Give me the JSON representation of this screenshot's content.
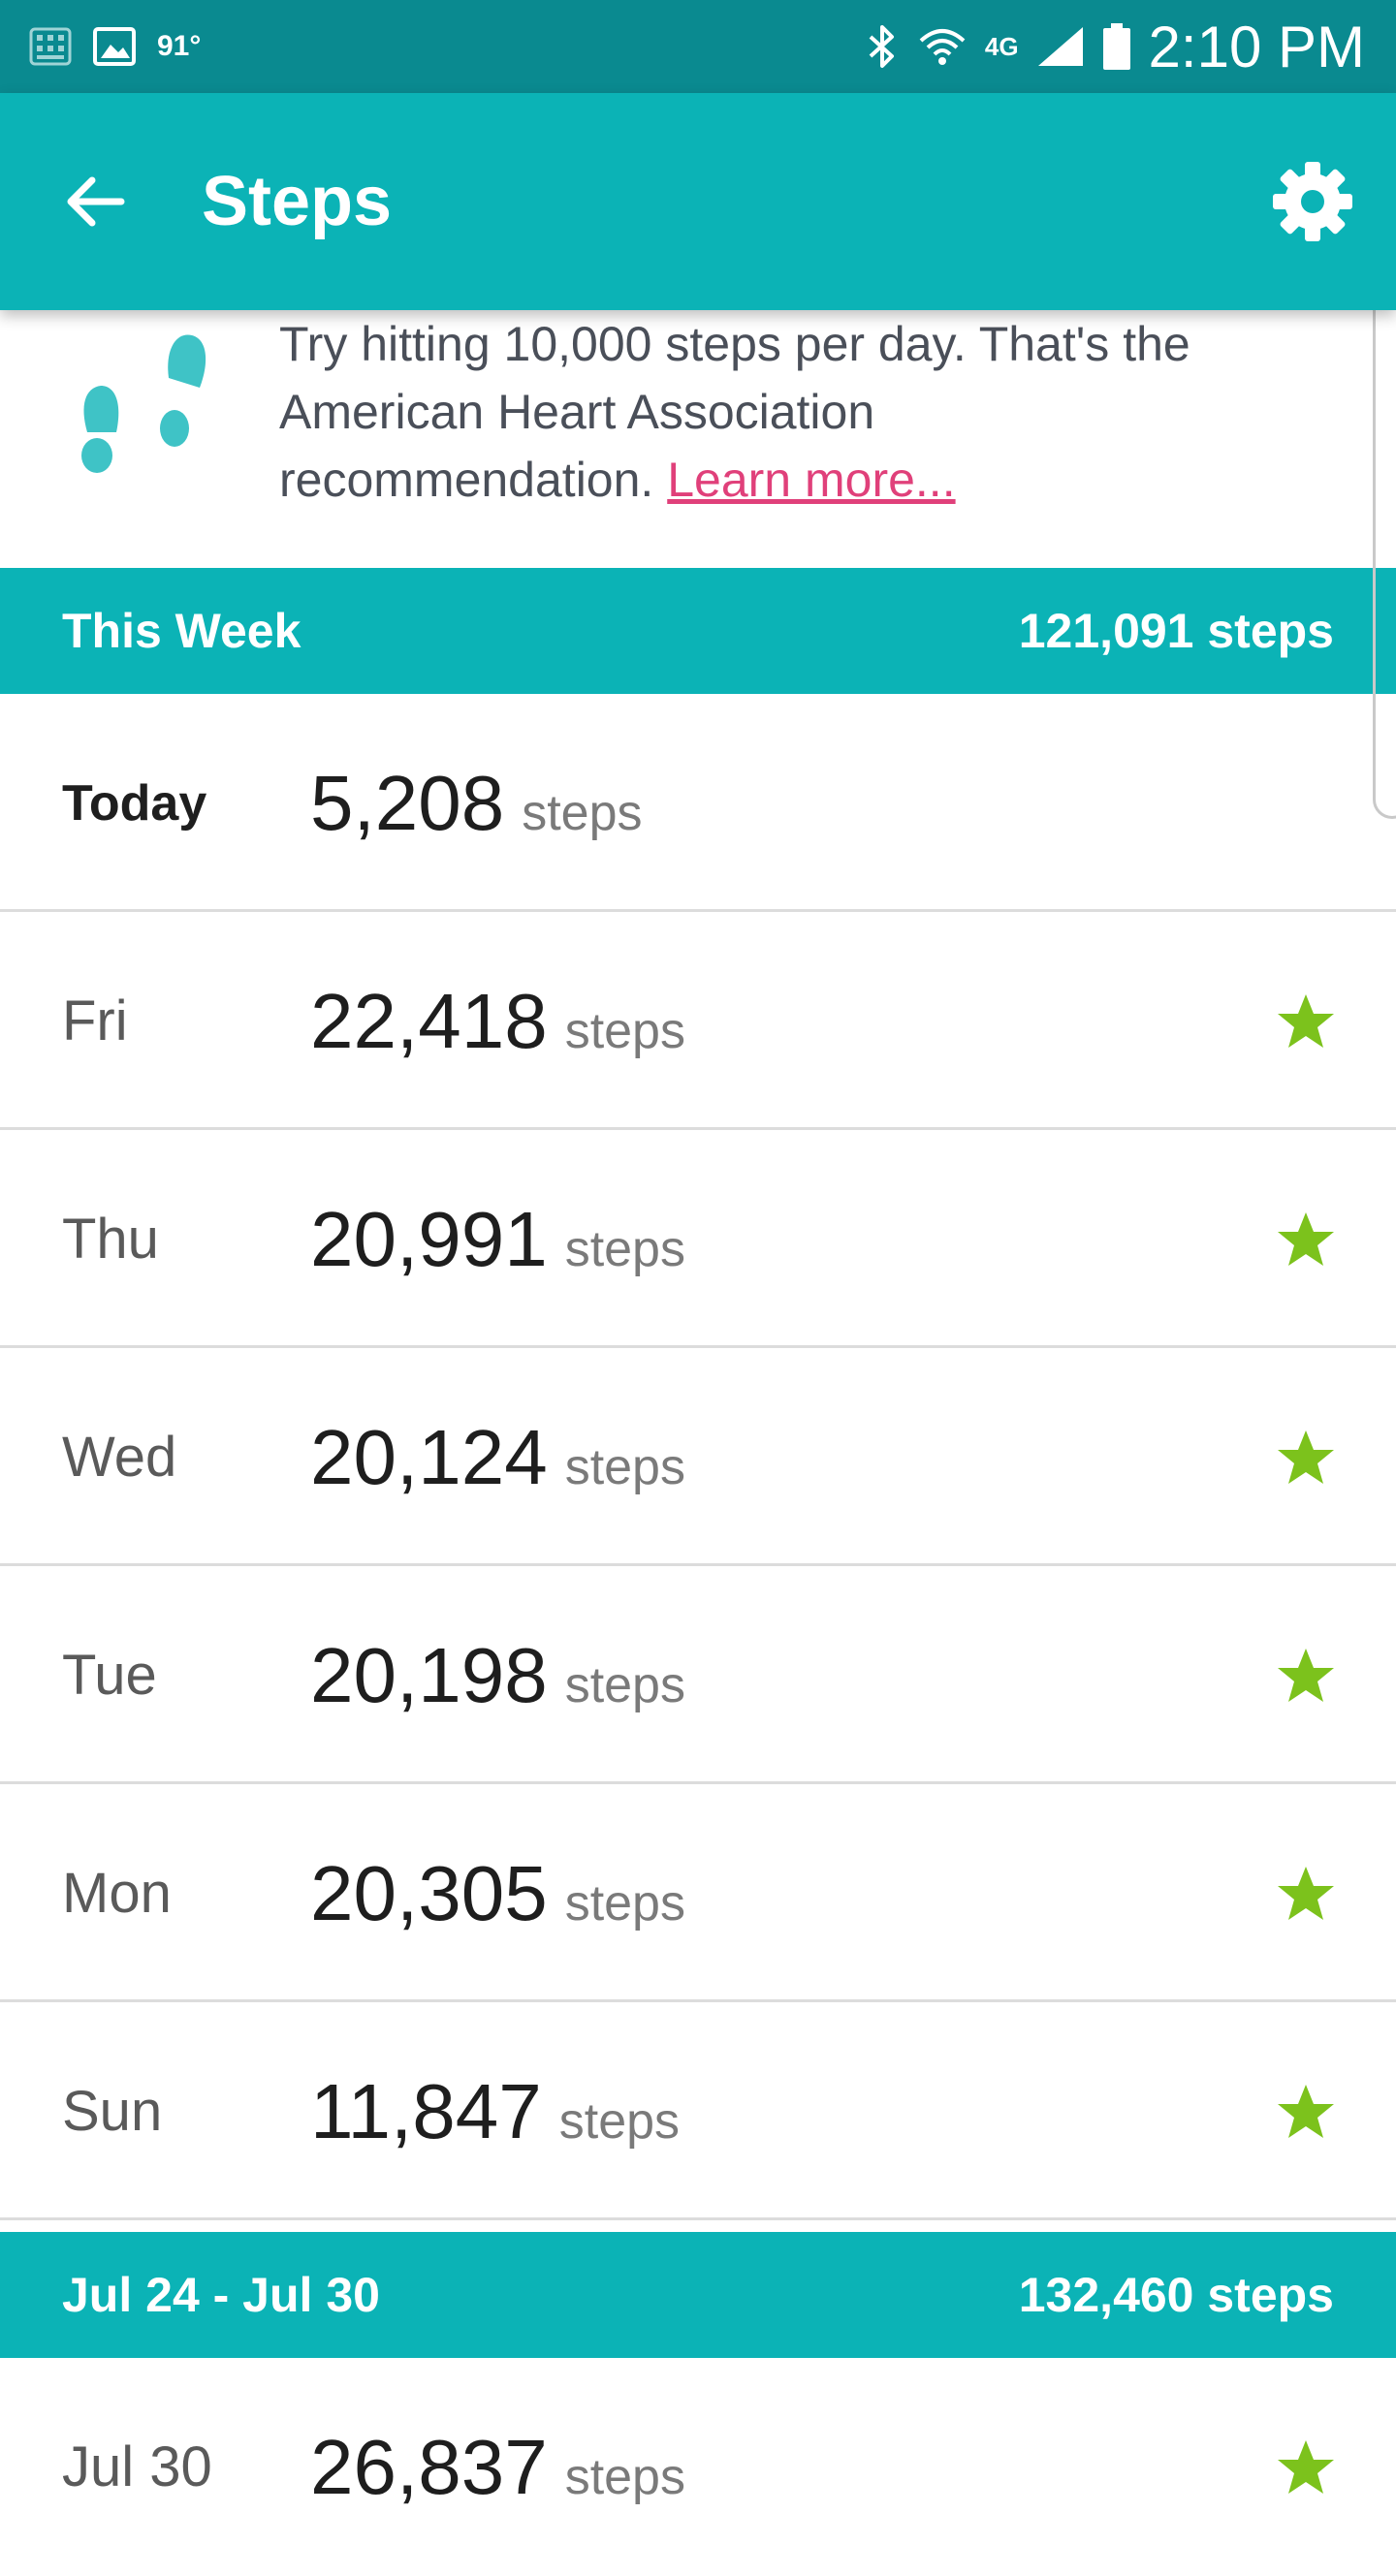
{
  "status_bar": {
    "temperature": "91°",
    "network": "4G",
    "time": "2:10 PM"
  },
  "app_bar": {
    "title": "Steps"
  },
  "tip": {
    "text": "Try hitting 10,000 steps per day. That's the American Heart Association recommendation.",
    "link": "Learn more..."
  },
  "this_week": {
    "label": "This Week",
    "total": "121,091 steps",
    "days": [
      {
        "day": "Today",
        "steps": "5,208",
        "unit": "steps",
        "goal_met": false
      },
      {
        "day": "Fri",
        "steps": "22,418",
        "unit": "steps",
        "goal_met": true
      },
      {
        "day": "Thu",
        "steps": "20,991",
        "unit": "steps",
        "goal_met": true
      },
      {
        "day": "Wed",
        "steps": "20,124",
        "unit": "steps",
        "goal_met": true
      },
      {
        "day": "Tue",
        "steps": "20,198",
        "unit": "steps",
        "goal_met": true
      },
      {
        "day": "Mon",
        "steps": "20,305",
        "unit": "steps",
        "goal_met": true
      },
      {
        "day": "Sun",
        "steps": "11,847",
        "unit": "steps",
        "goal_met": true
      }
    ]
  },
  "prev_week": {
    "label": "Jul 24 - Jul 30",
    "total": "132,460 steps",
    "days": [
      {
        "day": "Jul 30",
        "steps": "26,837",
        "unit": "steps",
        "goal_met": true
      }
    ]
  },
  "colors": {
    "status_bar": "#0a8a90",
    "app_bar": "#0bb3b6",
    "accent_link": "#e0407a",
    "star": "#7cc21c",
    "footprint": "#3fc3c6"
  }
}
